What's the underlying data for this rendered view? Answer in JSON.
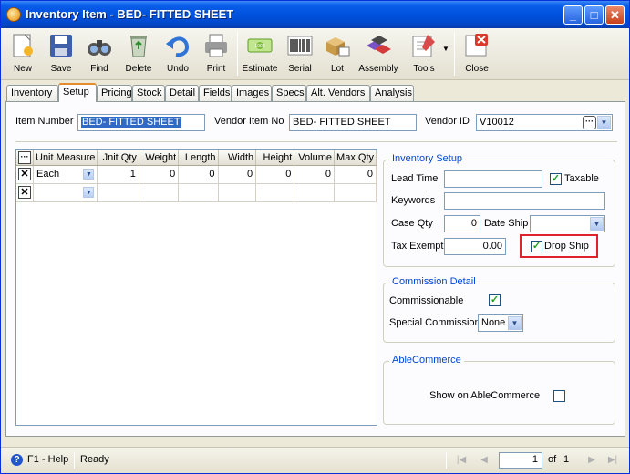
{
  "window": {
    "title": "Inventory Item - BED- FITTED SHEET"
  },
  "toolbar": {
    "new": "New",
    "save": "Save",
    "find": "Find",
    "delete": "Delete",
    "undo": "Undo",
    "print": "Print",
    "estimate": "Estimate",
    "serial": "Serial",
    "lot": "Lot",
    "assembly": "Assembly",
    "tools": "Tools",
    "close": "Close"
  },
  "tabs": [
    "Inventory",
    "Setup",
    "Pricing",
    "Stock",
    "Detail",
    "Fields",
    "Images",
    "Specs",
    "Alt. Vendors",
    "Analysis"
  ],
  "header": {
    "item_number_label": "Item Number",
    "item_number": "BED- FITTED SHEET",
    "vendor_item_no_label": "Vendor Item No",
    "vendor_item_no": "BED- FITTED SHEET",
    "vendor_id_label": "Vendor ID",
    "vendor_id": "V10012"
  },
  "grid": {
    "columns": [
      "Unit Measure",
      "Jnit Qty",
      "Weight",
      "Length",
      "Width",
      "Height",
      "Volume",
      "Max Qty"
    ],
    "rows": [
      {
        "unit": "Each",
        "unit_qty": "1",
        "weight": "0",
        "length": "0",
        "width": "0",
        "height": "0",
        "volume": "0",
        "max_qty": "0"
      }
    ]
  },
  "inventory_setup": {
    "title": "Inventory Setup",
    "lead_time_label": "Lead Time",
    "lead_time": "",
    "taxable_label": "Taxable",
    "taxable": true,
    "keywords_label": "Keywords",
    "keywords": "",
    "case_qty_label": "Case Qty",
    "case_qty": "0",
    "date_ship_label": "Date Ship",
    "date_ship": "",
    "tax_exempt_label": "Tax Exempt",
    "tax_exempt": "0.00",
    "drop_ship_label": "Drop Ship",
    "drop_ship": true
  },
  "commission": {
    "title": "Commission Detail",
    "commissionable_label": "Commissionable",
    "commissionable": true,
    "special_label": "Special Commission",
    "special_value": "None"
  },
  "ablecommerce": {
    "title": "AbleCommerce",
    "show_label": "Show on AbleCommerce",
    "show": false
  },
  "status": {
    "help": "F1 - Help",
    "state": "Ready",
    "page": "1",
    "of_label": "of",
    "total": "1"
  },
  "colors": {
    "accent": "#0046d5",
    "highlight": "#e0202a",
    "titlebar": "#0052df"
  }
}
